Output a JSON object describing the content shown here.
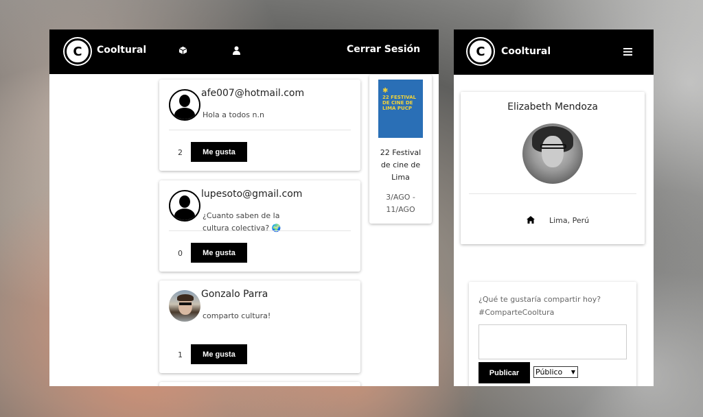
{
  "desktop": {
    "navbar": {
      "brand": "Cooltural",
      "logo_glyph": "C",
      "cube_icon": "cube-icon",
      "user_icon": "user-icon",
      "logout_label": "Cerrar Sesión"
    },
    "posts": [
      {
        "author": "afe007@hotmail.com",
        "content": "Hola a todos n.n",
        "likes": "2",
        "like_label": "Me gusta",
        "avatar": "default-avatar"
      },
      {
        "author": "lupesoto@gmail.com",
        "content": "¿Cuanto saben de la cultura colectiva? 🌍",
        "likes": "0",
        "like_label": "Me gusta",
        "avatar": "default-avatar"
      },
      {
        "author": "Gonzalo Parra",
        "content": "comparto cultura!",
        "likes": "1",
        "like_label": "Me gusta",
        "avatar": "photo-avatar"
      }
    ],
    "event": {
      "poster_star": "✱",
      "poster_text": "22 FESTIVAL DE CINE DE LIMA PUCP",
      "title": "22 Festival de cine de Lima",
      "date": "3/AGO - 11/AGO"
    }
  },
  "mobile": {
    "navbar": {
      "brand": "Cooltural",
      "logo_glyph": "C",
      "menu_icon": "hamburger-icon"
    },
    "profile": {
      "name": "Elizabeth Mendoza",
      "location": "Lima, Perú"
    },
    "compose": {
      "prompt_line1": "¿Qué te gustaría compartir hoy?",
      "prompt_line2": "#ComparteCooltura",
      "textarea_value": "",
      "publish_label": "Publicar",
      "visibility_selected": "Público"
    }
  }
}
